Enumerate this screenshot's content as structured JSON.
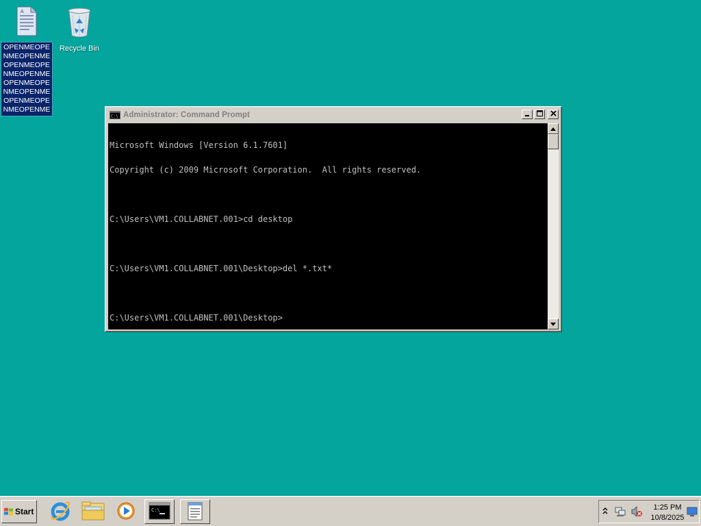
{
  "desktop": {
    "icons": [
      {
        "label": "OPENMEOPENMEOPENMEOPENMEOPENMEOPENMEOPENMEOPENMEOPENMEOPENMEOPENMEOPENME",
        "icon": "text-file-icon"
      },
      {
        "label": "Recycle Bin",
        "icon": "recycle-bin-icon"
      }
    ]
  },
  "window": {
    "title": "Administrator: Command Prompt",
    "console_lines": [
      "Microsoft Windows [Version 6.1.7601]",
      "Copyright (c) 2009 Microsoft Corporation.  All rights reserved.",
      "",
      "C:\\Users\\VM1.COLLABNET.001>cd desktop",
      "",
      "C:\\Users\\VM1.COLLABNET.001\\Desktop>del *.txt*",
      "",
      "C:\\Users\\VM1.COLLABNET.001\\Desktop>"
    ]
  },
  "taskbar": {
    "start_label": "Start",
    "items": [
      "internet-explorer-icon",
      "windows-explorer-icon",
      "media-player-icon",
      "command-prompt-icon",
      "notepad-icon"
    ],
    "clock_time": "1:25 PM",
    "clock_date": "10/8/2025"
  },
  "colors": {
    "desktop_bg": "#03a59c",
    "selection": "#0a246a",
    "console_bg": "#000000",
    "console_fg": "#c0c0c0"
  }
}
